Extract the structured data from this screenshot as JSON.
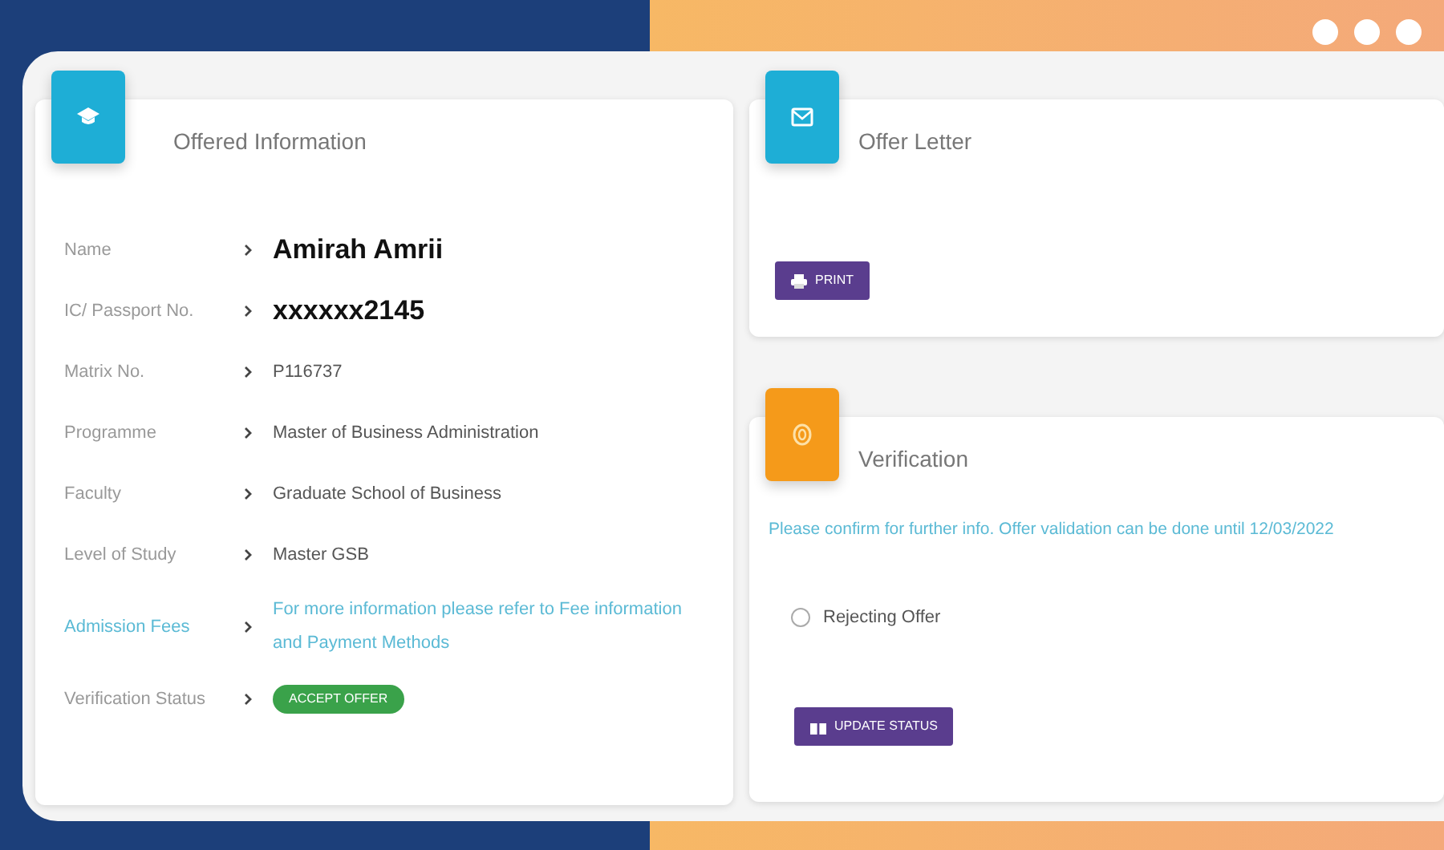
{
  "offered_information": {
    "title": "Offered Information",
    "rows": [
      {
        "label": "Name",
        "value": "Amirah Amrii",
        "kind": "emphasized"
      },
      {
        "label": "IC/ Passport No.",
        "value": "xxxxxx2145",
        "kind": "emphasized"
      },
      {
        "label": "Matrix No.",
        "value": "P116737",
        "kind": "plain"
      },
      {
        "label": "Programme",
        "value": "Master of Business Administration",
        "kind": "plain"
      },
      {
        "label": "Faculty",
        "value": "Graduate School of Business",
        "kind": "plain"
      },
      {
        "label": "Level of Study",
        "value": "Master GSB",
        "kind": "plain"
      },
      {
        "label": "Admission Fees",
        "value": "For more information please refer to Fee information and Payment Methods",
        "kind": "link"
      },
      {
        "label": "Verification Status",
        "value": "ACCEPT OFFER",
        "kind": "badge"
      }
    ]
  },
  "offer_letter": {
    "title": "Offer Letter",
    "button": "PRINT"
  },
  "verification": {
    "title": "Verification",
    "note": "Please confirm for further info. Offer validation can be done until 12/03/2022",
    "options": [
      {
        "label": "Rejecting Offer",
        "selected": false
      }
    ],
    "button": "UPDATE STATUS"
  }
}
